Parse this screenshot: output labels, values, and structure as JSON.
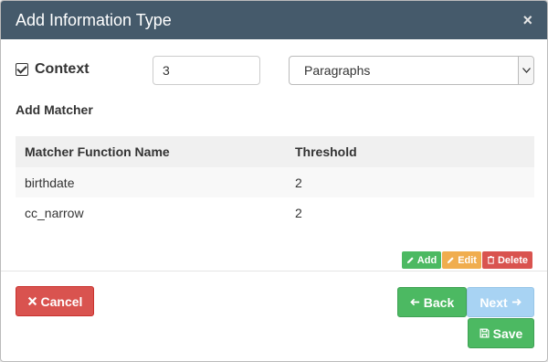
{
  "modal": {
    "title": "Add Information Type",
    "close": "×"
  },
  "context": {
    "label": "Context",
    "value": "3",
    "select_value": "Paragraphs"
  },
  "matcher": {
    "heading": "Add Matcher",
    "columns": [
      "Matcher Function Name",
      "Threshold"
    ],
    "rows": [
      {
        "name": "birthdate",
        "threshold": "2"
      },
      {
        "name": "cc_narrow",
        "threshold": "2"
      }
    ],
    "actions": {
      "add": "Add",
      "edit": "Edit",
      "delete": "Delete"
    }
  },
  "footer": {
    "cancel": "Cancel",
    "back": "Back",
    "next": "Next",
    "save": "Save"
  },
  "colors": {
    "header_bg": "#455a6b",
    "success": "#4cb962",
    "warning": "#f0ad4e",
    "danger": "#d9534f",
    "info_disabled": "#a8d3f3"
  },
  "icons": [
    "checkbox-icon",
    "chevron-down-icon",
    "pencil-icon",
    "trash-icon",
    "times-icon",
    "arrow-left-icon",
    "arrow-right-icon",
    "save-icon"
  ]
}
